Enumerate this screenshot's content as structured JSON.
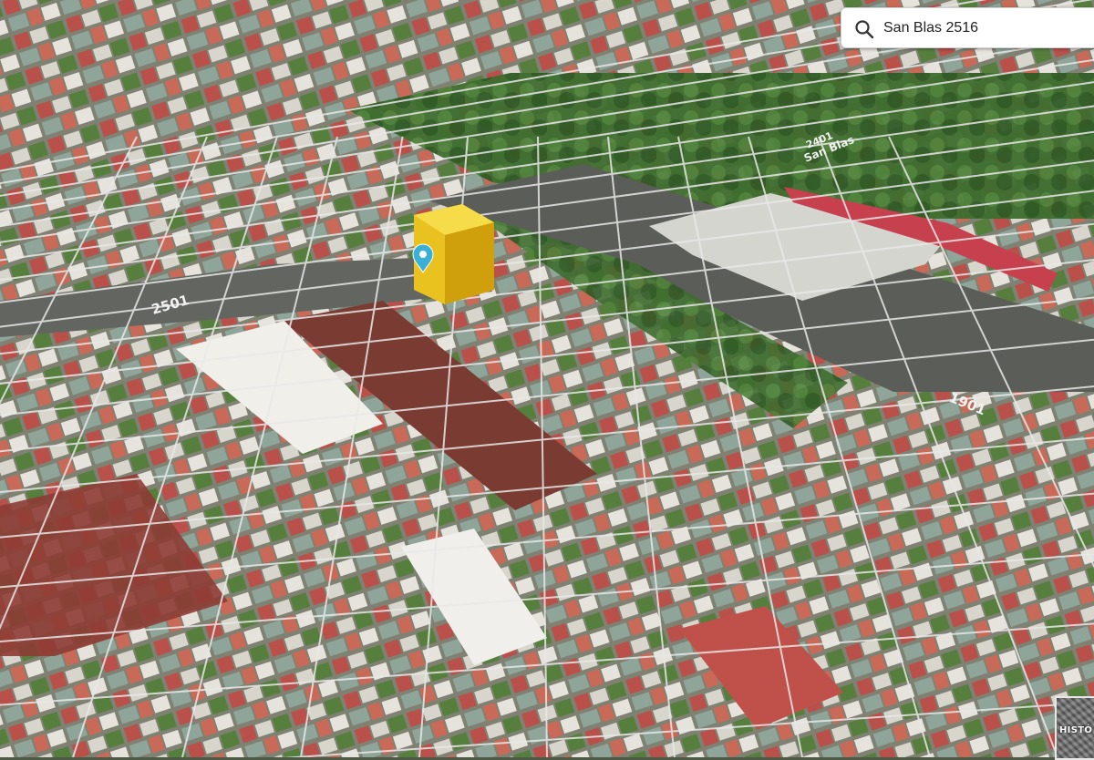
{
  "search": {
    "value": "San Blas 2516",
    "icon": "search-icon"
  },
  "map": {
    "street_labels": [
      {
        "text": "2501",
        "key": "label-2501"
      },
      {
        "text": "1901",
        "key": "label-1901"
      },
      {
        "text": "2401",
        "key": "label-2401"
      },
      {
        "text": "San Blas",
        "key": "label-san-blas"
      }
    ],
    "marker_icon": "location-pin-icon",
    "highlight_color": "#f2cc1a",
    "pin_color": "#3ab0d6"
  },
  "history_thumb": {
    "label": "HISTÓ"
  }
}
